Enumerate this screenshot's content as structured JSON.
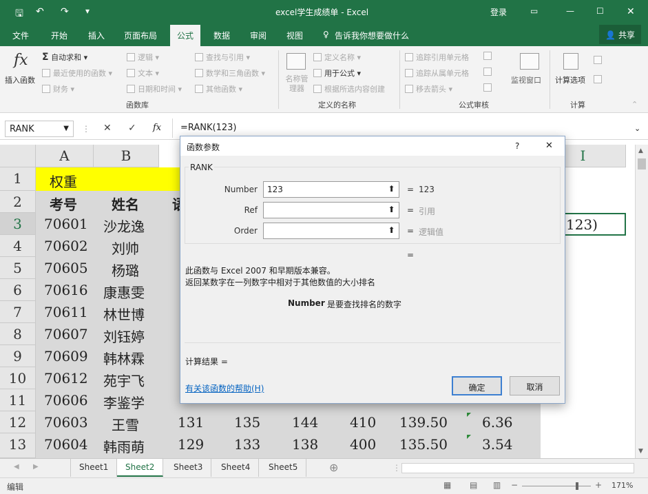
{
  "titlebar": {
    "title": "excel学生成绩单 - Excel",
    "login": "登录"
  },
  "tabs": [
    "文件",
    "开始",
    "插入",
    "页面布局",
    "公式",
    "数据",
    "审阅",
    "视图"
  ],
  "tell_me": "告诉我你想要做什么",
  "share": "共享",
  "ribbon": {
    "insert_function": "插入函数",
    "autosum": "自动求和",
    "recent": "最近使用的函数",
    "financial": "财务",
    "logical": "逻辑",
    "text": "文本",
    "datetime": "日期和时间",
    "lookup": "查找与引用",
    "math": "数学和三角函数",
    "other": "其他函数",
    "group_library": "函数库",
    "name_manager": "名称管理器",
    "define_name": "定义名称",
    "use_in_formula": "用于公式",
    "create_from_sel": "根据所选内容创建",
    "group_names": "定义的名称",
    "trace_precedents": "追踪引用单元格",
    "trace_dependents": "追踪从属单元格",
    "remove_arrows": "移去箭头",
    "group_audit": "公式审核",
    "watch_window": "监视窗口",
    "calc_options": "计算选项",
    "group_calc": "计算"
  },
  "formula_bar": {
    "name_box": "RANK",
    "cancel": "✕",
    "enter": "✓",
    "fx": "fx",
    "formula": "=RANK(123)"
  },
  "columns": [
    "A",
    "B",
    "I"
  ],
  "rows": [
    {
      "num": "1",
      "a": "权重",
      "b": ""
    },
    {
      "num": "2",
      "a": "考号",
      "b": "姓名"
    },
    {
      "num": "3",
      "a": "70601",
      "b": "沙龙逸"
    },
    {
      "num": "4",
      "a": "70602",
      "b": "刘帅"
    },
    {
      "num": "5",
      "a": "70605",
      "b": "杨璐"
    },
    {
      "num": "6",
      "a": "70616",
      "b": "康惠雯"
    },
    {
      "num": "7",
      "a": "70611",
      "b": "林世博"
    },
    {
      "num": "8",
      "a": "70607",
      "b": "刘钰婷"
    },
    {
      "num": "9",
      "a": "70609",
      "b": "韩林霖"
    },
    {
      "num": "10",
      "a": "70612",
      "b": "苑宇飞"
    },
    {
      "num": "11",
      "a": "70606",
      "b": "李鉴学"
    },
    {
      "num": "12",
      "a": "70603",
      "b": "王雪"
    },
    {
      "num": "13",
      "a": "70604",
      "b": "韩雨萌"
    }
  ],
  "row2_c": "语",
  "row12_rest": [
    "131",
    "135",
    "144",
    "410",
    "139.50",
    "6.36"
  ],
  "row13_rest": [
    "129",
    "133",
    "138",
    "400",
    "135.50",
    "3.54"
  ],
  "i3_value": "123)",
  "sheets": [
    "Sheet1",
    "Sheet2",
    "Sheet3",
    "Sheet4",
    "Sheet5"
  ],
  "active_sheet": "Sheet2",
  "status": {
    "mode": "编辑",
    "zoom": "171%"
  },
  "dialog": {
    "title": "函数参数",
    "help_q": "?",
    "close": "✕",
    "func_name": "RANK",
    "args": [
      {
        "label": "Number",
        "value": "123",
        "result": "123"
      },
      {
        "label": "Ref",
        "value": "",
        "result": "引用"
      },
      {
        "label": "Order",
        "value": "",
        "result": "逻辑值"
      }
    ],
    "equals": "=",
    "desc1": "此函数与 Excel 2007 和早期版本兼容。",
    "desc2": "返回某数字在一列数字中相对于其他数值的大小排名",
    "arg_help_name": "Number",
    "arg_help_text": "是要查找排名的数字",
    "calc_result": "计算结果 =",
    "help_link": "有关该函数的帮助(H)",
    "ok": "确定",
    "cancel": "取消"
  },
  "colors": {
    "excel_green": "#217346",
    "weight_yellow": "#ffff00",
    "link_blue": "#0563c1"
  }
}
